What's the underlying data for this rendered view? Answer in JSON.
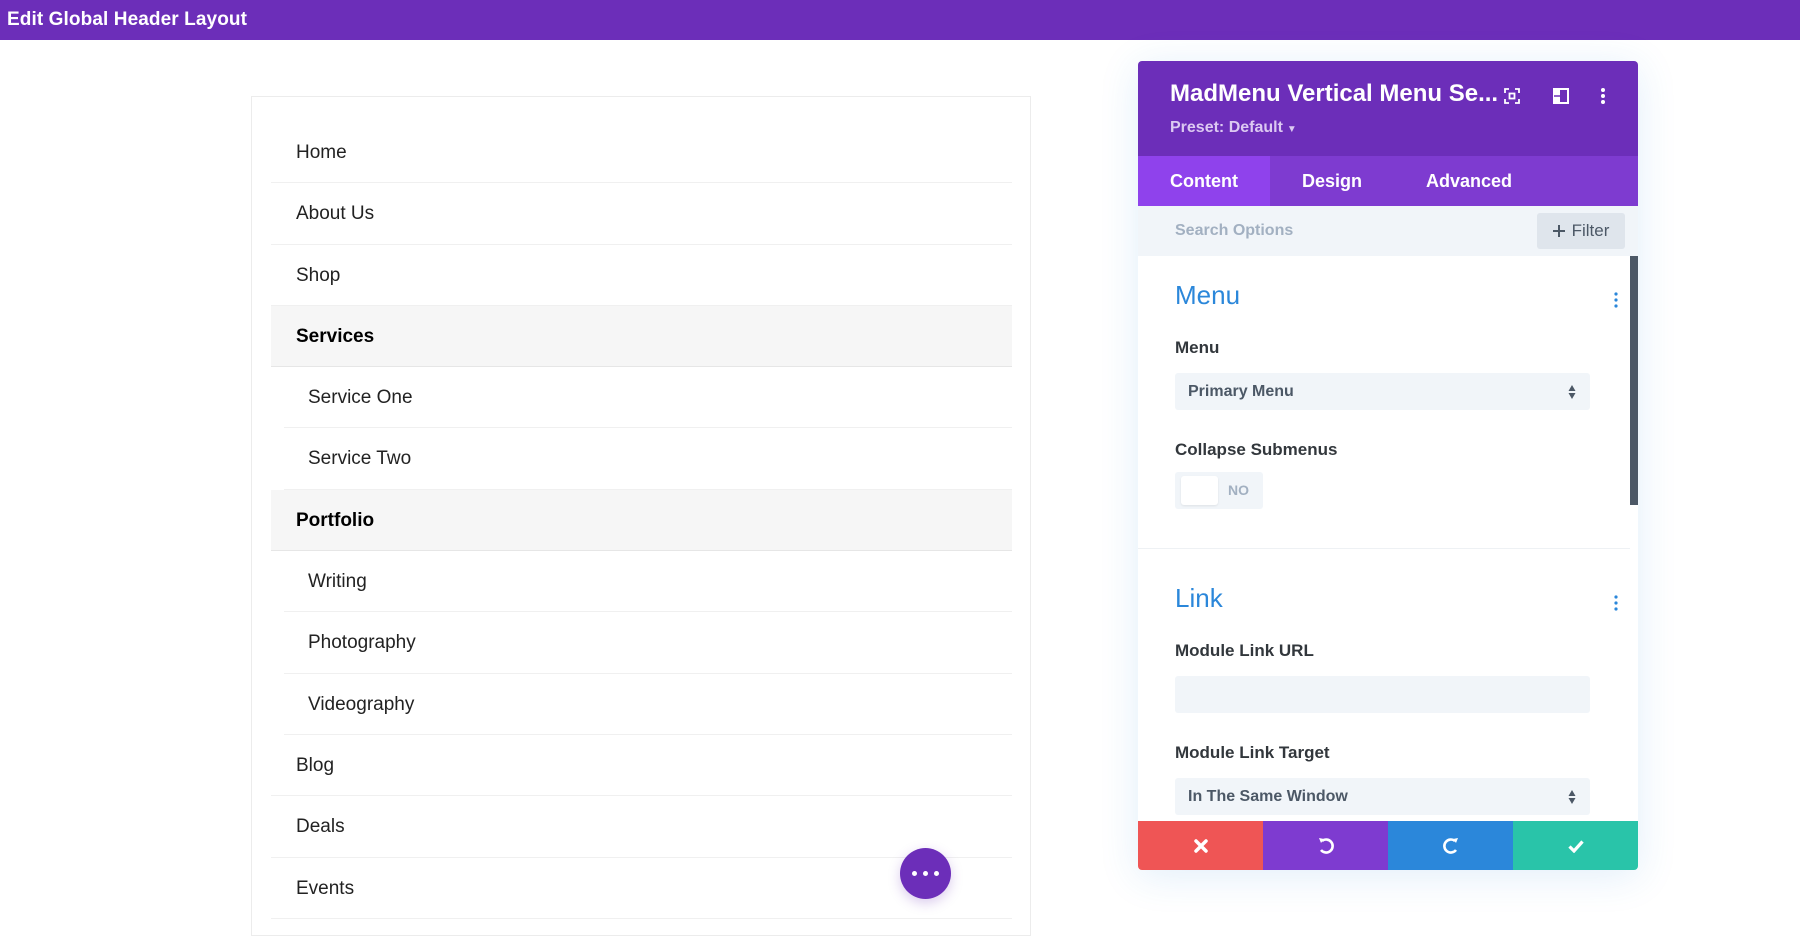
{
  "topbar": {
    "title": "Edit Global Header Layout"
  },
  "menu": {
    "items": [
      {
        "label": "Home",
        "type": "top"
      },
      {
        "label": "About Us",
        "type": "top"
      },
      {
        "label": "Shop",
        "type": "top"
      },
      {
        "label": "Services",
        "type": "parent"
      },
      {
        "label": "Service One",
        "type": "sub"
      },
      {
        "label": "Service Two",
        "type": "sub"
      },
      {
        "label": "Portfolio",
        "type": "parent"
      },
      {
        "label": "Writing",
        "type": "sub"
      },
      {
        "label": "Photography",
        "type": "sub"
      },
      {
        "label": "Videography",
        "type": "sub"
      },
      {
        "label": "Blog",
        "type": "top"
      },
      {
        "label": "Deals",
        "type": "top"
      },
      {
        "label": "Events",
        "type": "top"
      }
    ]
  },
  "fab": {
    "icon": "more-horizontal-icon"
  },
  "panel": {
    "title": "MadMenu Vertical Menu Se...",
    "preset": "Preset: Default",
    "header_icons": [
      "expand-icon",
      "split-view-icon",
      "more-vertical-icon"
    ],
    "tabs": [
      {
        "label": "Content",
        "active": true
      },
      {
        "label": "Design",
        "active": false
      },
      {
        "label": "Advanced",
        "active": false
      }
    ],
    "search": {
      "placeholder": "Search Options",
      "value": ""
    },
    "filter_label": "Filter",
    "sections": {
      "menu": {
        "title": "Menu",
        "menu_label": "Menu",
        "menu_value": "Primary Menu",
        "collapse_label": "Collapse Submenus",
        "collapse_value": "NO"
      },
      "link": {
        "title": "Link",
        "url_label": "Module Link URL",
        "url_value": "",
        "target_label": "Module Link Target",
        "target_value": "In The Same Window"
      }
    },
    "footer": {
      "buttons": [
        "close",
        "undo",
        "redo",
        "save"
      ]
    }
  },
  "colors": {
    "brand_purple": "#6c2eb9",
    "tab_purple": "#7e3bd0",
    "tab_active": "#8f42ec",
    "accent_blue": "#2b87da",
    "close_red": "#ef5555",
    "save_green": "#29c4a9"
  }
}
